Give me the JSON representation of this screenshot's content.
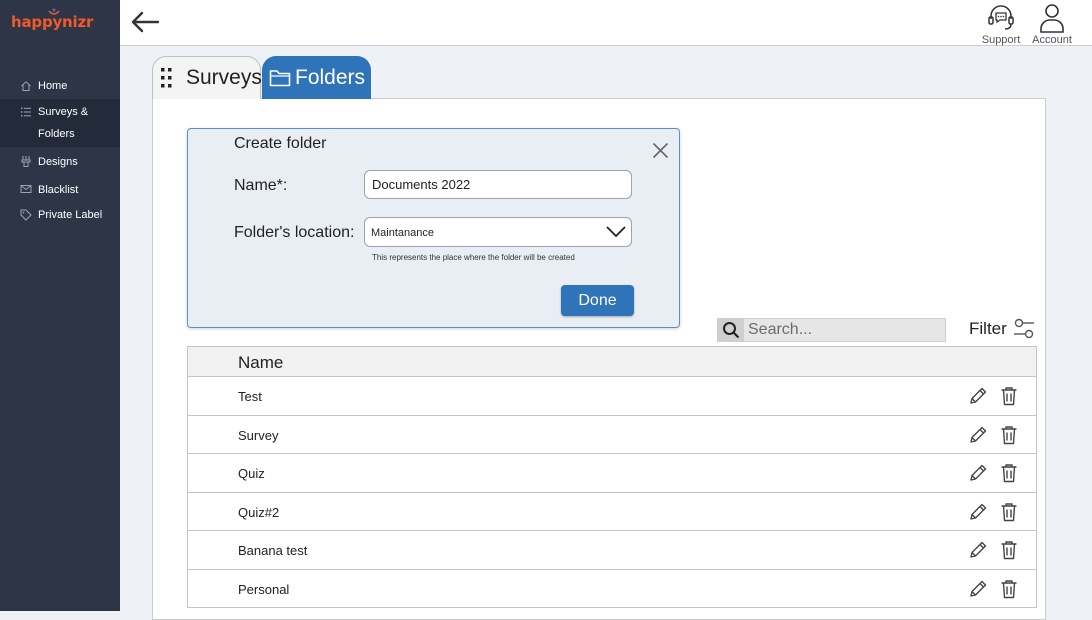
{
  "app": {
    "logo_text": "happynizr",
    "brand_color": "#f05a28",
    "accent_color": "#2f73b9"
  },
  "sidebar": {
    "items": [
      {
        "label": "Home",
        "icon": "home-icon"
      },
      {
        "label": "Surveys &",
        "label2": "Folders",
        "icon": "list-icon",
        "active": true
      },
      {
        "label": "Designs",
        "icon": "designs-icon"
      },
      {
        "label": "Blacklist",
        "icon": "mail-icon"
      },
      {
        "label": "Private Label",
        "icon": "tag-icon"
      }
    ]
  },
  "topbar": {
    "support_label": "Support",
    "account_label": "Account"
  },
  "tabs": [
    {
      "label": "Surveys",
      "icon": "list-icon",
      "active": false
    },
    {
      "label": "Folders",
      "icon": "folder-icon",
      "active": true
    }
  ],
  "dialog": {
    "title": "Create folder",
    "name_label": "Name*:",
    "name_value": "Documents 2022",
    "location_label": "Folder's location:",
    "location_value": "Maintanance",
    "location_hint": "This represents the place where the folder will be created",
    "done_label": "Done"
  },
  "search": {
    "placeholder": "Search..."
  },
  "filter": {
    "label": "Filter"
  },
  "table": {
    "header": "Name",
    "rows": [
      "Test",
      "Survey",
      "Quiz",
      "Quiz#2",
      "Banana test",
      "Personal"
    ]
  }
}
